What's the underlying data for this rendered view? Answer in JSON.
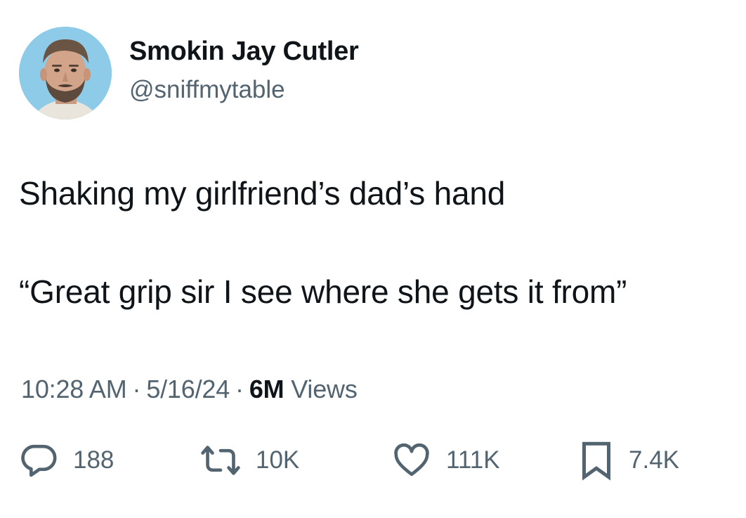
{
  "author": {
    "name": "Smokin Jay Cutler",
    "handle": "@sniffmytable",
    "avatar_icon": "profile-photo"
  },
  "tweet": {
    "lines": [
      "Shaking my girlfriend’s dad’s hand",
      "“Great grip sir I see where she gets it from”"
    ]
  },
  "meta": {
    "time": "10:28 AM",
    "separator": "·",
    "date": "5/16/24",
    "views_count": "6M",
    "views_label": "Views"
  },
  "actions": {
    "reply": {
      "icon": "reply-icon",
      "count": "188"
    },
    "repost": {
      "icon": "repost-icon",
      "count": "10K"
    },
    "like": {
      "icon": "heart-icon",
      "count": "111K"
    },
    "bookmark": {
      "icon": "bookmark-icon",
      "count": "7.4K"
    }
  },
  "colors": {
    "text": "#0f1419",
    "secondary": "#536471",
    "avatar_bg": "#8dc8e6"
  }
}
